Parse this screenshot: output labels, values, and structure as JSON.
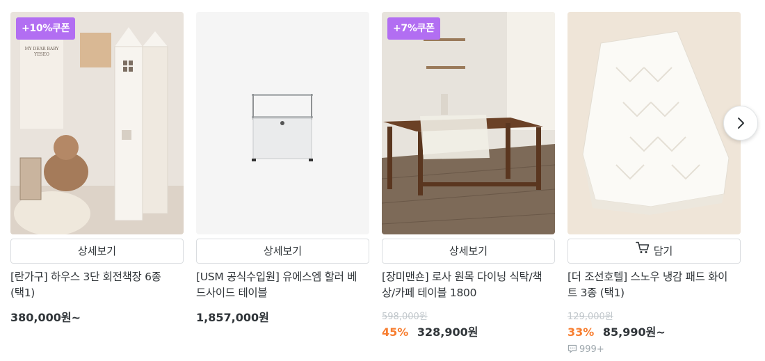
{
  "products": [
    {
      "coupon": "+10%쿠폰",
      "button_label": "상세보기",
      "title": "[란가구] 하우스 3단 회전책장 6종 (택1)",
      "price": "380,000원~"
    },
    {
      "button_label": "상세보기",
      "title": "[USM 공식수입원] 유에스엠 할러 베드사이드 테이블",
      "price": "1,857,000원"
    },
    {
      "coupon": "+7%쿠폰",
      "button_label": "상세보기",
      "title": "[장미맨숀] 로사 원목 다이닝 식탁/책상/카페 테이블 1800",
      "original_price": "598,000원",
      "discount": "45%",
      "price": "328,900원"
    },
    {
      "button_label": "담기",
      "button_icon": "cart-icon",
      "title": "[더 조선호텔] 스노우 냉감 패드 화이트 3종 (택1)",
      "original_price": "129,000원",
      "discount": "33%",
      "price": "85,990원~",
      "review_count": "999+"
    }
  ],
  "colors": {
    "coupon": "#b26ef2",
    "discount": "#f77d2f",
    "text": "#2f3438",
    "muted": "#c2c8cc"
  },
  "next_icon": "chevron-right-icon"
}
